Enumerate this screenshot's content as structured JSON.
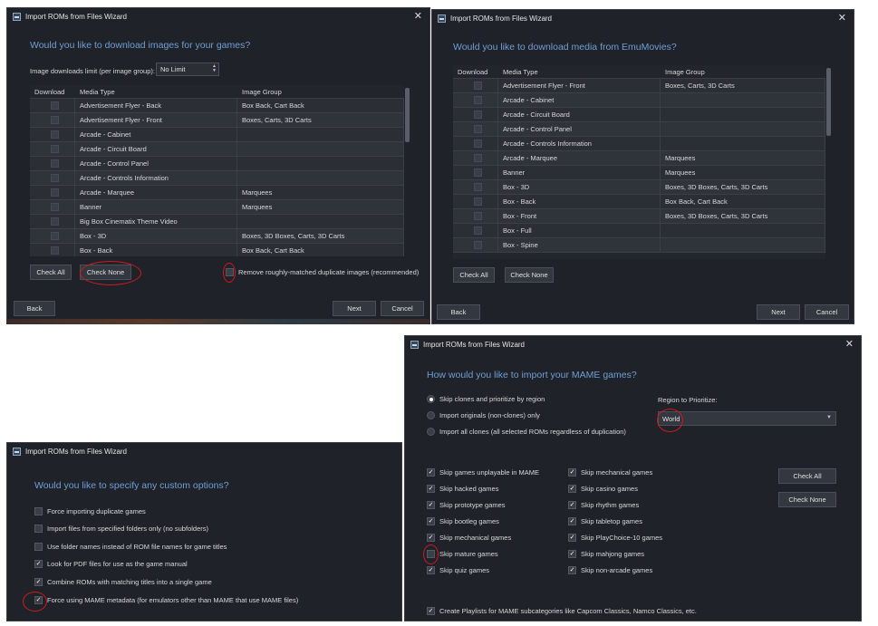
{
  "win1": {
    "title": "Import ROMs from Files Wizard",
    "heading": "Would you like to download images for your games?",
    "limit_label": "Image downloads limit (per image group):",
    "limit_value": "No Limit",
    "columns": [
      "Download",
      "Media Type",
      "Image Group"
    ],
    "rows": [
      {
        "media": "Advertisement Flyer - Back",
        "group": "Box Back, Cart Back"
      },
      {
        "media": "Advertisement Flyer - Front",
        "group": "Boxes, Carts, 3D Carts"
      },
      {
        "media": "Arcade - Cabinet",
        "group": ""
      },
      {
        "media": "Arcade - Circuit Board",
        "group": ""
      },
      {
        "media": "Arcade - Control Panel",
        "group": ""
      },
      {
        "media": "Arcade - Controls Information",
        "group": ""
      },
      {
        "media": "Arcade - Marquee",
        "group": "Marquees"
      },
      {
        "media": "Banner",
        "group": "Marquees"
      },
      {
        "media": "Big Box Cinematix Theme Video",
        "group": ""
      },
      {
        "media": "Box - 3D",
        "group": "Boxes, 3D Boxes, Carts, 3D Carts"
      },
      {
        "media": "Box - Back",
        "group": "Box Back, Cart Back"
      }
    ],
    "check_all": "Check All",
    "check_none": "Check None",
    "remove_dupes": "Remove roughly-matched duplicate images (recommended)",
    "back": "Back",
    "next": "Next",
    "cancel": "Cancel"
  },
  "win2": {
    "title": "Import ROMs from Files Wizard",
    "heading": "Would you like to download media from EmuMovies?",
    "columns": [
      "Download",
      "Media Type",
      "Image Group"
    ],
    "rows": [
      {
        "media": "Advertisement Flyer - Front",
        "group": "Boxes, Carts, 3D Carts"
      },
      {
        "media": "Arcade - Cabinet",
        "group": ""
      },
      {
        "media": "Arcade - Circuit Board",
        "group": ""
      },
      {
        "media": "Arcade - Control Panel",
        "group": ""
      },
      {
        "media": "Arcade - Controls Information",
        "group": ""
      },
      {
        "media": "Arcade - Marquee",
        "group": "Marquees"
      },
      {
        "media": "Banner",
        "group": "Marquees"
      },
      {
        "media": "Box - 3D",
        "group": "Boxes, 3D Boxes, Carts, 3D Carts"
      },
      {
        "media": "Box - Back",
        "group": "Box Back, Cart Back"
      },
      {
        "media": "Box - Front",
        "group": "Boxes, 3D Boxes, Carts, 3D Carts"
      },
      {
        "media": "Box - Full",
        "group": ""
      },
      {
        "media": "Box - Spine",
        "group": ""
      }
    ],
    "check_all": "Check All",
    "check_none": "Check None",
    "back": "Back",
    "next": "Next",
    "cancel": "Cancel"
  },
  "win3": {
    "title": "Import ROMs from Files Wizard",
    "heading": "Would you like to specify any custom options?",
    "options": [
      {
        "label": "Force importing duplicate games",
        "checked": false
      },
      {
        "label": "Import files from specified folders only (no subfolders)",
        "checked": false
      },
      {
        "label": "Use folder names instead of ROM file names for game titles",
        "checked": false
      },
      {
        "label": "Look for PDF files for use as the game manual",
        "checked": true
      },
      {
        "label": "Combine ROMs with matching titles into a single game",
        "checked": true
      },
      {
        "label": "Force using MAME metadata (for emulators other than MAME that use MAME files)",
        "checked": true
      }
    ]
  },
  "win4": {
    "title": "Import ROMs from Files Wizard",
    "heading": "How would you like to import your MAME games?",
    "radios": [
      {
        "label": "Skip clones and prioritize by region",
        "selected": true
      },
      {
        "label": "Import originals (non-clones) only",
        "selected": false
      },
      {
        "label": "Import all clones (all selected ROMs regardless of duplication)",
        "selected": false
      }
    ],
    "region_label": "Region to Prioritize:",
    "region_value": "World",
    "left_checks": [
      {
        "label": "Skip games unplayable in MAME",
        "checked": true
      },
      {
        "label": "Skip hacked games",
        "checked": true
      },
      {
        "label": "Skip prototype games",
        "checked": true
      },
      {
        "label": "Skip bootleg games",
        "checked": true
      },
      {
        "label": "Skip mechanical games",
        "checked": true
      },
      {
        "label": "Skip mature games",
        "checked": false
      },
      {
        "label": "Skip quiz games",
        "checked": true
      }
    ],
    "right_checks": [
      {
        "label": "Skip mechanical games",
        "checked": true
      },
      {
        "label": "Skip casino games",
        "checked": true
      },
      {
        "label": "Skip rhythm games",
        "checked": true
      },
      {
        "label": "Skip tabletop games",
        "checked": true
      },
      {
        "label": "Skip PlayChoice-10 games",
        "checked": true
      },
      {
        "label": "Skip mahjong games",
        "checked": true
      },
      {
        "label": "Skip non-arcade games",
        "checked": true
      }
    ],
    "check_all": "Check All",
    "check_none": "Check None",
    "playlists": "Create Playlists for MAME subcategories like Capcom Classics, Namco Classics, etc.",
    "playlists_checked": true
  },
  "colors": {
    "background": "#1f2228",
    "heading": "#6f9fd6",
    "annotation": "#d21a1a"
  }
}
